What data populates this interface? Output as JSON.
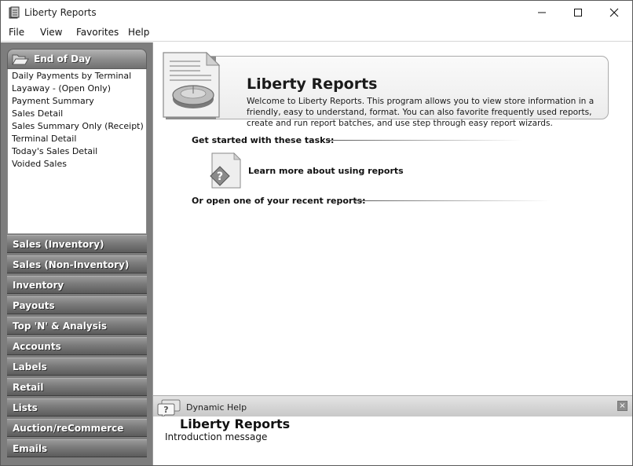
{
  "window": {
    "title": "Liberty Reports"
  },
  "menu": [
    "File",
    "View",
    "Favorites",
    "Help"
  ],
  "sidebar": {
    "active_group": "End of Day",
    "links": [
      "Daily Payments by Terminal",
      "Layaway - (Open Only)",
      "Payment Summary",
      "Sales Detail",
      "Sales Summary Only (Receipt)",
      "Terminal Detail",
      "Today's Sales Detail",
      "Voided Sales"
    ],
    "categories": [
      "Sales (Inventory)",
      "Sales (Non-Inventory)",
      "Inventory",
      "Payouts",
      "Top 'N' & Analysis",
      "Accounts",
      "Labels",
      "Retail",
      "Lists",
      "Auction/reCommerce",
      "Emails"
    ]
  },
  "welcome": {
    "title": "Liberty Reports",
    "description": "Welcome to Liberty Reports. This program allows you to view store information in a friendly, easy to understand, format. You can also favorite frequently used reports, create and run report batches, and use step through easy report wizards."
  },
  "tasks": {
    "heading": "Get started with these tasks:",
    "learn_more": "Learn more about using reports",
    "recent_heading": "Or open one of your recent reports:"
  },
  "dynamic_help": {
    "label": "Dynamic Help",
    "title": "Liberty Reports",
    "message": "Introduction message",
    "close_glyph": "×"
  },
  "icons": {
    "app": "report-book-icon",
    "window_controls": [
      "minimize-icon",
      "maximize-icon",
      "close-icon"
    ],
    "group": "open-folder-icon",
    "welcome": "report-document-icon",
    "task": "help-document-icon",
    "help": "help-bubble-icon"
  }
}
